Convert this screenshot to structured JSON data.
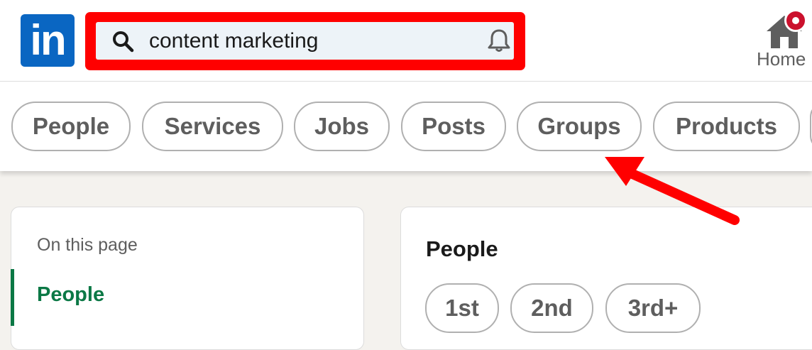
{
  "header": {
    "logo_text": "in",
    "search": {
      "value": "content marketing"
    },
    "nav": {
      "home_label": "Home"
    }
  },
  "filters": [
    "People",
    "Services",
    "Jobs",
    "Posts",
    "Groups",
    "Products"
  ],
  "sidebar": {
    "heading": "On this page",
    "active_item": "People"
  },
  "main": {
    "section_title": "People",
    "degree_filters": [
      "1st",
      "2nd",
      "3rd+"
    ]
  },
  "colors": {
    "brand": "#0a66c2",
    "highlight": "#ff0000",
    "active_green": "#0b7845",
    "badge_red": "#cb112d"
  }
}
